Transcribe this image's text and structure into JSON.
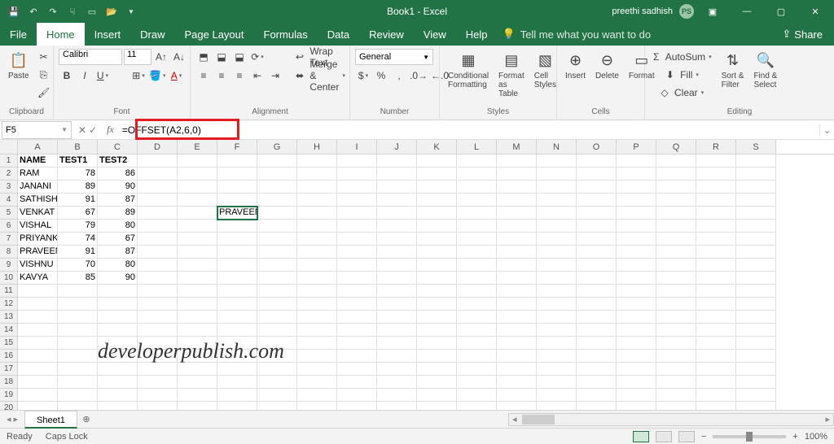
{
  "title": "Book1 - Excel",
  "user": {
    "name": "preethi sadhish",
    "initials": "PS"
  },
  "qat": [
    "save",
    "undo",
    "redo",
    "touch",
    "new",
    "open"
  ],
  "menu": {
    "file": "File",
    "home": "Home",
    "insert": "Insert",
    "draw": "Draw",
    "layout": "Page Layout",
    "formulas": "Formulas",
    "data": "Data",
    "review": "Review",
    "view": "View",
    "help": "Help",
    "tellme": "Tell me what you want to do",
    "share": "Share"
  },
  "ribbon": {
    "clipboard": {
      "label": "Clipboard",
      "paste": "Paste"
    },
    "font": {
      "label": "Font",
      "name": "Calibri",
      "size": "11"
    },
    "alignment": {
      "label": "Alignment",
      "wrap": "Wrap Text",
      "merge": "Merge & Center"
    },
    "number": {
      "label": "Number",
      "format": "General"
    },
    "styles": {
      "label": "Styles",
      "cond": "Conditional\nFormatting",
      "table": "Format as\nTable",
      "cell": "Cell\nStyles"
    },
    "cells": {
      "label": "Cells",
      "insert": "Insert",
      "delete": "Delete",
      "format": "Format"
    },
    "editing": {
      "label": "Editing",
      "autosum": "AutoSum",
      "fill": "Fill",
      "clear": "Clear",
      "sort": "Sort &\nFilter",
      "find": "Find &\nSelect"
    }
  },
  "namebox": "F5",
  "formula": "=OFFSET(A2,6,0)",
  "columns": [
    "A",
    "B",
    "C",
    "D",
    "E",
    "F",
    "G",
    "H",
    "I",
    "J",
    "K",
    "L",
    "M",
    "N",
    "O",
    "P",
    "Q",
    "R",
    "S"
  ],
  "headers": [
    "NAME",
    "TEST1",
    "TEST2"
  ],
  "data": [
    {
      "name": "RAM",
      "t1": 78,
      "t2": 86
    },
    {
      "name": "JANANI",
      "t1": 89,
      "t2": 90
    },
    {
      "name": "SATHISH",
      "t1": 91,
      "t2": 87
    },
    {
      "name": "VENKAT",
      "t1": 67,
      "t2": 89
    },
    {
      "name": "VISHAL",
      "t1": 79,
      "t2": 80
    },
    {
      "name": "PRIYANKA",
      "t1": 74,
      "t2": 67
    },
    {
      "name": "PRAVEEN",
      "t1": 91,
      "t2": 87
    },
    {
      "name": "VISHNU",
      "t1": 70,
      "t2": 80
    },
    {
      "name": "KAVYA",
      "t1": 85,
      "t2": 90
    }
  ],
  "selected_cell_value": "PRAVEEN",
  "watermark": "developerpublish.com",
  "sheet": "Sheet1",
  "status": {
    "ready": "Ready",
    "caps": "Caps Lock",
    "zoom": "100%"
  }
}
